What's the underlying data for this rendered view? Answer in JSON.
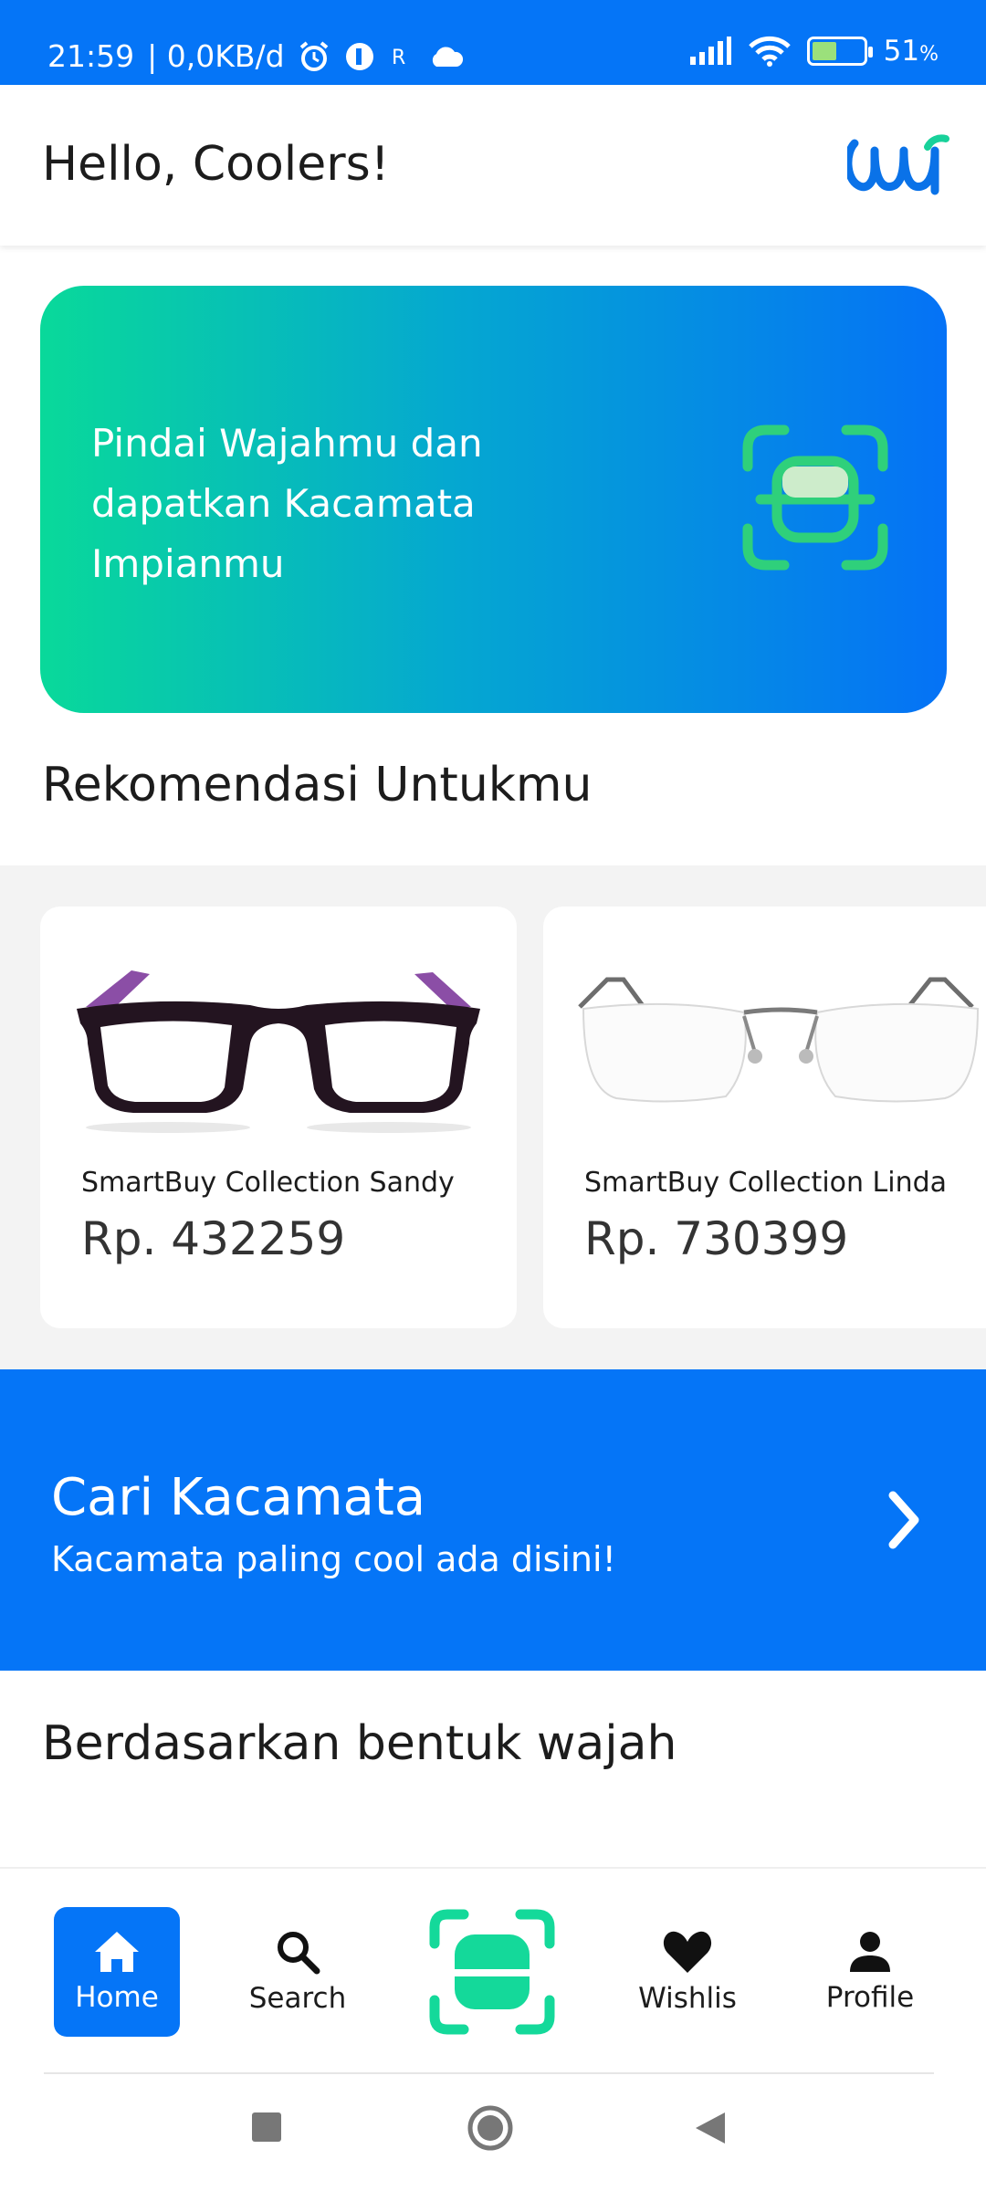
{
  "status_bar": {
    "time": "21:59",
    "speed": "| 0,0KB/d",
    "battery": "51",
    "battery_unit": "%",
    "icons": [
      "alarm-icon",
      "app-icon",
      "r-icon",
      "cloud-icon",
      "signal-icon",
      "wifi-icon",
      "battery-icon"
    ]
  },
  "header": {
    "greeting": "Hello, Coolers!"
  },
  "scan_banner": {
    "text": "Pindai Wajahmu dan dapatkan Kacamata Impianmu",
    "icon": "face-scan-icon"
  },
  "recommendations": {
    "title": "Rekomendasi Untukmu",
    "items": [
      {
        "name": "SmartBuy Collection Sandy",
        "price": "Rp. 432259"
      },
      {
        "name": "SmartBuy Collection Linda",
        "price": "Rp. 730399"
      }
    ]
  },
  "search_banner": {
    "title": "Cari Kacamata",
    "subtitle": "Kacamata paling cool ada disini!",
    "icon": "chevron-right-icon"
  },
  "face_shape": {
    "title": "Berdasarkan bentuk wajah"
  },
  "bottom_nav": {
    "home": "Home",
    "search": "Search",
    "wishlist": "Wishlis",
    "profile": "Profile"
  },
  "colors": {
    "primary": "#0575f7",
    "accent": "#09d99a"
  }
}
